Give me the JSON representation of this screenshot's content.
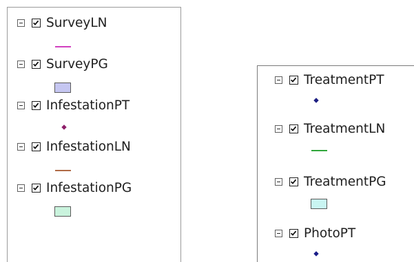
{
  "layers": {
    "panel_left": [
      {
        "label": "SurveyLN",
        "symbol": "line",
        "color": "#d13fbf",
        "checked": true,
        "expanded": true
      },
      {
        "label": "SurveyPG",
        "symbol": "polygon",
        "color": "#c5c6f1",
        "checked": true,
        "expanded": true
      },
      {
        "label": "InfestationPT",
        "symbol": "point",
        "color": "#8e1f6a",
        "checked": true,
        "expanded": true
      },
      {
        "label": "InfestationLN",
        "symbol": "line",
        "color": "#b06a45",
        "checked": true,
        "expanded": true
      },
      {
        "label": "InfestationPG",
        "symbol": "polygon",
        "color": "#c9f3dd",
        "checked": true,
        "expanded": true
      }
    ],
    "panel_right": [
      {
        "label": "TreatmentPT",
        "symbol": "point",
        "color": "#1d1f82",
        "checked": true,
        "expanded": true
      },
      {
        "label": "TreatmentLN",
        "symbol": "line",
        "color": "#2fa63a",
        "checked": true,
        "expanded": true
      },
      {
        "label": "TreatmentPG",
        "symbol": "polygon",
        "color": "#c9f5f2",
        "checked": true,
        "expanded": true
      },
      {
        "label": "PhotoPT",
        "symbol": "point",
        "color": "#1b1e89",
        "checked": true,
        "expanded": true
      }
    ]
  }
}
